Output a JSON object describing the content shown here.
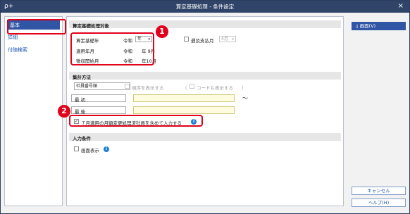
{
  "window": {
    "title": "算定基礎処理 - 条件設定",
    "close_glyph": "×",
    "app_icon_glyph": "ρ+"
  },
  "nav": {
    "items": [
      {
        "label": "基本",
        "selected": true
      },
      {
        "label": "詳細",
        "selected": false
      },
      {
        "label": "付随検索",
        "selected": false
      }
    ]
  },
  "target": {
    "header": "算定基礎処理対象",
    "base_year_label": "算定基礎年",
    "base_year_era": "令和",
    "base_year_select": "年",
    "apply_month_label": "適用年月",
    "apply_month_value": "令和　　年 9月",
    "collection_label": "徴収開始月",
    "collection_value": "令和　　年10月",
    "retro_checkbox_label": "遡及支払月",
    "retro_month_select": "4月"
  },
  "tally": {
    "header": "集計方法",
    "order_select": "社員番号順",
    "show_order_label": "順序を表示する",
    "paren_open": "（",
    "show_code_label": "コードも表示する",
    "paren_close": "）",
    "first_label": "最 初",
    "last_label": "最 後",
    "tilde": "～",
    "include_july_label": "７月適用の月額変更処理済社員を含めて入力する",
    "include_july_checked": "✓"
  },
  "input_cond": {
    "header": "入力条件",
    "screen_display_label": "画面表示"
  },
  "buttons": {
    "screen": "画面(V)",
    "cancel": "キャンセル",
    "help": "ヘルプ(H)"
  },
  "badges": {
    "one": "1",
    "two": "2"
  },
  "colors": {
    "titlebar": "#2f4468",
    "accent": "#2f55a4",
    "highlight": "#e2001a",
    "input_bg": "#fffce0"
  }
}
